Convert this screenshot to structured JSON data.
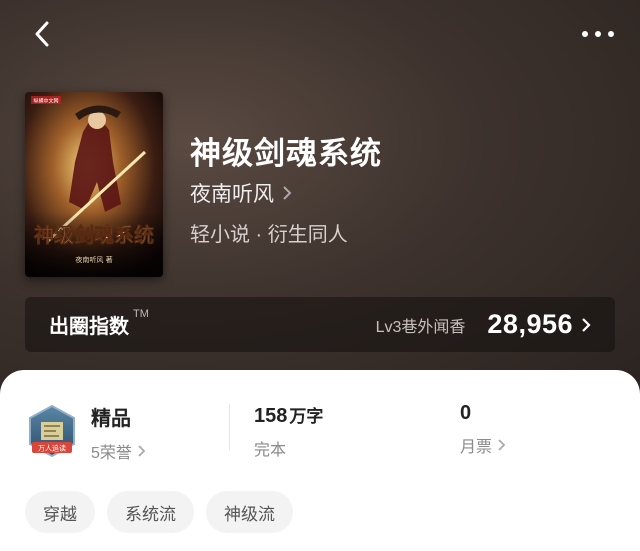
{
  "header": {
    "back_icon": "chevron-left-icon",
    "more_icon": "more-dots-icon"
  },
  "book": {
    "title": "神级剑魂系统",
    "author": "夜南听风",
    "genre": "轻小说 · 衍生同人",
    "cover": {
      "title_art": "神级剑魂系统",
      "author_credit": "夜南听风 著",
      "publisher_mark": "纵横中文网"
    }
  },
  "index": {
    "label": "出圈指数",
    "trademark": "TM",
    "level": "Lv3巷外闻香",
    "value": "28,956"
  },
  "stats": {
    "honor": {
      "title": "精品",
      "sub": "5荣誉",
      "badge_text": "万人追读"
    },
    "words": {
      "value": "158",
      "unit": "万字",
      "sub": "完本"
    },
    "tickets": {
      "value": "0",
      "sub": "月票"
    }
  },
  "tags": [
    "穿越",
    "系统流",
    "神级流"
  ],
  "colors": {
    "hero_bg": "#3d322d",
    "panel_bg": "#ffffff",
    "tag_bg": "#f3f3f3",
    "badge_ribbon": "#d8473a"
  }
}
